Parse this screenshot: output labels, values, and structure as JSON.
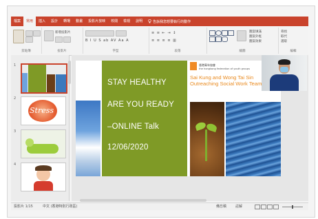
{
  "ribbon": {
    "tabs": [
      "檔案",
      "常用",
      "插入",
      "設計",
      "轉場",
      "動畫",
      "投影片放映",
      "校閱",
      "檢視",
      "說明"
    ],
    "active_tab_index": 1,
    "tell_me": "告訴我您想要執行的動作",
    "accent_color": "#c9432c",
    "groups": {
      "clipboard_label": "剪貼簿",
      "slides_label": "投影片",
      "font_label": "字型",
      "paragraph_label": "段落",
      "drawing_label": "繪圖",
      "editing_label": "編輯"
    },
    "new_slide": "新增投影片",
    "shape_fill": "圖案填滿",
    "shape_outline": "圖案外框",
    "shape_effects": "圖案效果",
    "find": "尋找",
    "replace": "取代",
    "select": "選取"
  },
  "thumbnails": [
    {
      "number": "1",
      "selected": true,
      "content": "title-slide"
    },
    {
      "number": "2",
      "selected": false,
      "text": "Stress"
    },
    {
      "number": "3",
      "selected": false,
      "content": "relaxing-figure"
    },
    {
      "number": "4",
      "selected": false,
      "content": "stressed-character"
    }
  ],
  "slide": {
    "line1": "STAY HEALTHY",
    "line2": "ARE YOU READY",
    "line3": "–ONLINE Talk",
    "line4": "12/06/2020",
    "org_name_cn": "香港青年協會",
    "org_name_en": "the hongkong federation of youth groups",
    "team_line1": "Sai Kung and Wong Tai Sin",
    "team_line2": "Outreaching Social Work Team",
    "green_color": "#7f9a26",
    "orange_color": "#e98a1f"
  },
  "statusbar": {
    "slide_counter": "投影片 1/15",
    "language": "中文 (香港特別行政區)",
    "notes": "備忘稿",
    "comments": "註解"
  }
}
